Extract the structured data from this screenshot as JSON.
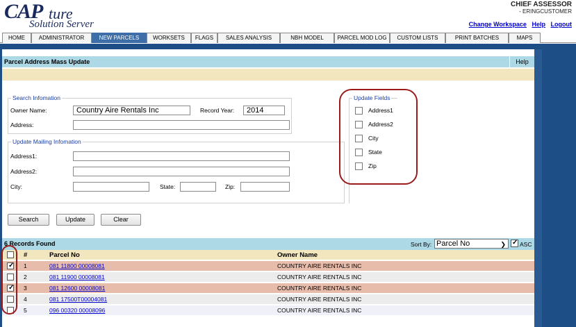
{
  "header": {
    "logo_main": "CAP",
    "logo_script": "ture",
    "logo_sub": "Solution Server",
    "user_role": "CHIEF ASSESSOR",
    "user_name": "- ERINGCUSTOMER",
    "links": [
      "Change Workspace",
      "Help",
      "Logout"
    ]
  },
  "nav": {
    "tabs": [
      {
        "label": "HOME",
        "active": false
      },
      {
        "label": "ADMINISTRATOR",
        "active": false
      },
      {
        "label": "NEW PARCELS",
        "active": true
      },
      {
        "label": "WORKSETS",
        "active": false
      },
      {
        "label": "FLAGS",
        "active": false
      },
      {
        "label": "SALES ANALYSIS",
        "active": false
      },
      {
        "label": "NBH MODEL",
        "active": false
      },
      {
        "label": "PARCEL MOD LOG",
        "active": false
      },
      {
        "label": "CUSTOM LISTS",
        "active": false
      },
      {
        "label": "PRINT BATCHES",
        "active": false
      },
      {
        "label": "MAPS",
        "active": false
      }
    ]
  },
  "page": {
    "title": "Parcel Address Mass Update",
    "help": "Help"
  },
  "search": {
    "legend": "Search Infomation",
    "owner_label": "Owner Name:",
    "owner_value": "Country Aire Rentals Inc",
    "year_label": "Record Year:",
    "year_value": "2014",
    "address_label": "Address:",
    "address_value": ""
  },
  "mailing": {
    "legend": "Update Mailing Infomation",
    "address1_label": "Address1:",
    "address2_label": "Address2:",
    "city_label": "City:",
    "state_label": "State:",
    "zip_label": "Zip:"
  },
  "update_fields": {
    "legend": "Update Fields",
    "options": [
      {
        "label": "Address1",
        "checked": false
      },
      {
        "label": "Address2",
        "checked": false
      },
      {
        "label": "City",
        "checked": false
      },
      {
        "label": "State",
        "checked": false
      },
      {
        "label": "Zip",
        "checked": false
      }
    ]
  },
  "buttons": {
    "search": "Search",
    "update": "Update",
    "clear": "Clear"
  },
  "results": {
    "count_text": "6 Records Found",
    "sort_label": "Sort By:",
    "sort_value": "Parcel No",
    "asc_label": "ASC",
    "asc_checked": true,
    "columns": {
      "num": "#",
      "parcel": "Parcel No",
      "owner": "Owner Name"
    },
    "rows": [
      {
        "num": "1",
        "parcel": "081 11800 00008081",
        "owner": "COUNTRY AIRE RENTALS INC",
        "checked": true
      },
      {
        "num": "2",
        "parcel": "081 11900 00008081",
        "owner": "COUNTRY AIRE RENTALS INC",
        "checked": false
      },
      {
        "num": "3",
        "parcel": "081 12600 00008081",
        "owner": "COUNTRY AIRE RENTALS INC",
        "checked": true
      },
      {
        "num": "4",
        "parcel": "081 17500T00004081",
        "owner": "COUNTRY AIRE RENTALS INC",
        "checked": false
      },
      {
        "num": "5",
        "parcel": "096 00320 00008096",
        "owner": "COUNTRY AIRE RENTALS INC",
        "checked": false
      }
    ]
  },
  "colors": {
    "nav_active": "#3d6ea7",
    "frame_blue": "#1e4e86",
    "title_bar": "#add8e6",
    "yellow_bar": "#f2e6bf",
    "checked_row": "#e8bcab",
    "legend_text": "#1a3ea8",
    "link": "#0000cc",
    "annotation_oval": "#9b1b1b"
  }
}
